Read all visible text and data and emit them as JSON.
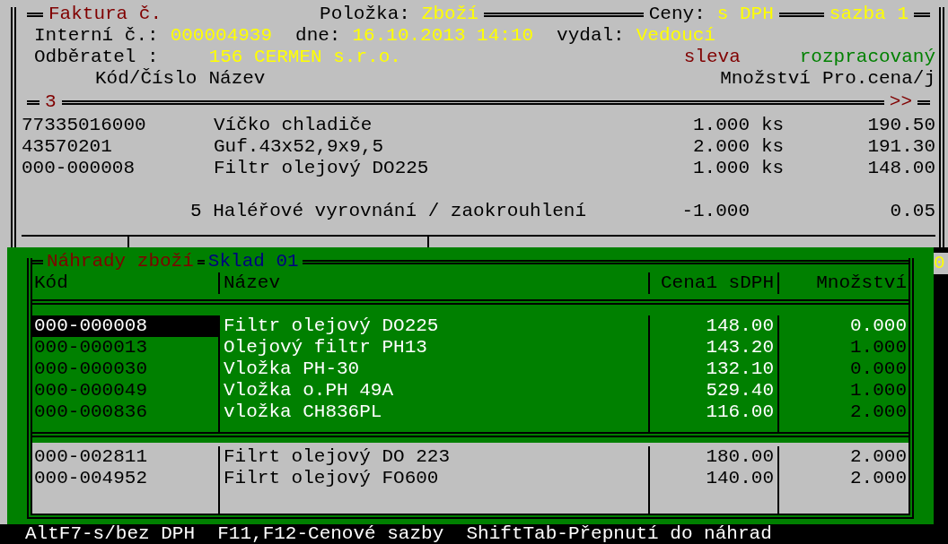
{
  "header": {
    "title": "Faktura č.",
    "item_label": "Položka:",
    "item_value": "Zboží",
    "prices_label": "Ceny:",
    "prices_value": "s DPH",
    "rate": "sazba 1"
  },
  "info": {
    "internal_label": "Interní č.:",
    "internal_value": "000004939",
    "date_label": "dne:",
    "date_value": "16.10.2013 14:10",
    "issuer_label": "vydal:",
    "issuer_value": "Vedoucí",
    "customer_label": "Odběratel :",
    "customer_value": "156 CERMEN s.r.o.",
    "discount": "sleva",
    "status": "rozpracovaný"
  },
  "table": {
    "columns": [
      "Kód/Číslo",
      "Název",
      "Množství",
      "Pro.cena/j"
    ],
    "count": "3",
    "more": ">>",
    "rows": [
      {
        "code": "77335016000",
        "name": "Víčko chladiče",
        "quantity": "1.000",
        "unit": "ks",
        "price": "190.50"
      },
      {
        "code": "43570201",
        "name": "Guf.43x52,9x9,5",
        "quantity": "2.000",
        "unit": "ks",
        "price": "191.30"
      },
      {
        "code": "000-000008",
        "name": "Filtr olejový DO225",
        "quantity": "1.000",
        "unit": "ks",
        "price": "148.00"
      }
    ],
    "rounding": {
      "text": "5 Haléřové vyrovnání / zaokrouhlení",
      "quantity": "-1.000",
      "price": "0.05"
    }
  },
  "edge_text": "0",
  "replacements": {
    "title": "Náhrady zboží",
    "warehouse": "Sklad 01",
    "columns": [
      "Kód",
      "Název",
      "Cena1 sDPH",
      "Množství"
    ],
    "groups": [
      {
        "kind": "primary",
        "rows": [
          {
            "code": "000-000008",
            "name": "Filtr olejový DO225",
            "price": "148.00",
            "quantity": "0.000",
            "selected": true
          },
          {
            "code": "000-000013",
            "name": "Olejový filtr PH13",
            "price": "143.20",
            "quantity": "1.000",
            "selected": false
          },
          {
            "code": "000-000030",
            "name": "Vložka PH-30",
            "price": "132.10",
            "quantity": "0.000",
            "selected": false
          },
          {
            "code": "000-000049",
            "name": "Vložka o.PH 49A",
            "price": "529.40",
            "quantity": "1.000",
            "selected": false
          },
          {
            "code": "000-000836",
            "name": "vložka CH836PL",
            "price": "116.00",
            "quantity": "2.000",
            "selected": false
          }
        ]
      },
      {
        "kind": "secondary",
        "rows": [
          {
            "code": "000-002811",
            "name": "Filrt olejový DO 223",
            "price": "180.00",
            "quantity": "2.000",
            "selected": false
          },
          {
            "code": "000-004952",
            "name": "Filrt olejový FO600",
            "price": "140.00",
            "quantity": "2.000",
            "selected": false
          }
        ]
      }
    ]
  },
  "status_bar": "AltF7-s/bez DPH  F11,F12-Cenové sazby  ShiftTab-Přepnutí do náhrad"
}
